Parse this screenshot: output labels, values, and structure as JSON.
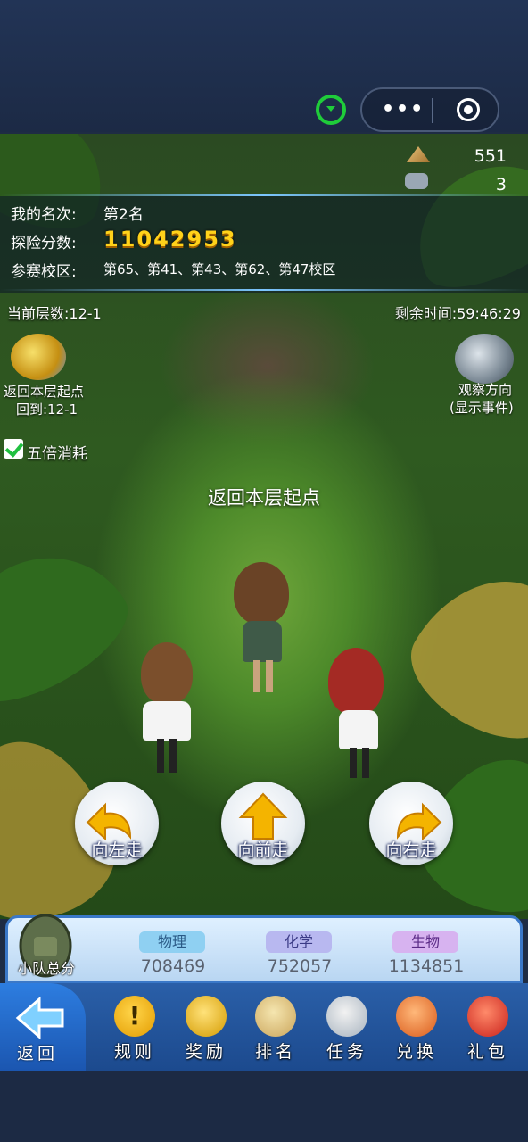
{
  "status": {
    "resource_1": "551",
    "resource_2": "3"
  },
  "info": {
    "rank_label": "我的名次:",
    "rank_value": "第2名",
    "score_label": "探险分数:",
    "score_value": "11042953",
    "campus_label": "参赛校区:",
    "campus_value": "第65、第41、第43、第62、第47校区"
  },
  "game": {
    "current_floor": "当前层数:12-1",
    "remaining_time": "剩余时间:59:46:29",
    "return_start_line1": "返回本层起点",
    "return_start_line2": "回到:12-1",
    "observe_line1": "观察方向",
    "observe_line2": "(显示事件)",
    "five_times": "五倍消耗",
    "five_times_checked": true,
    "center_message": "返回本层起点"
  },
  "moves": {
    "left": "向左走",
    "forward": "向前走",
    "right": "向右走"
  },
  "team": {
    "label": "小队总分",
    "subjects": [
      {
        "name": "物理",
        "score": "708469",
        "color": "#8fd0f2"
      },
      {
        "name": "化学",
        "score": "752057",
        "color": "#b8b8f0"
      },
      {
        "name": "生物",
        "score": "1134851",
        "color": "#d7b3f0"
      }
    ]
  },
  "nav": {
    "back": "返回",
    "rules": "规则",
    "reward": "奖励",
    "ranking": "排名",
    "tasks": "任务",
    "exchange": "兑换",
    "gift": "礼包"
  }
}
